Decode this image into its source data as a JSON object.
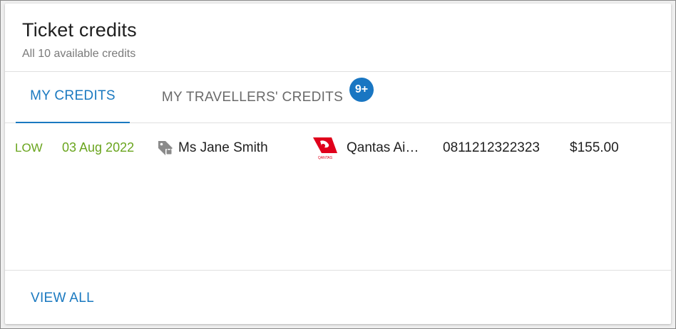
{
  "header": {
    "title": "Ticket credits",
    "subtitle": "All 10 available credits"
  },
  "tabs": [
    {
      "label": "MY CREDITS",
      "active": true
    },
    {
      "label": "MY TRAVELLERS' CREDITS",
      "active": false,
      "badge": "9+"
    }
  ],
  "credits": [
    {
      "status": "LOW",
      "date": "03 Aug 2022",
      "traveller_icon": "tag-lock-icon",
      "traveller": "Ms Jane Smith",
      "airline_icon": "qantas-logo",
      "airline": "Qantas Airways",
      "airline_display": "Qantas Ai…",
      "ticket_number": "0811212322323",
      "amount": "$155.00"
    }
  ],
  "footer": {
    "view_all_label": "VIEW ALL"
  },
  "colors": {
    "accent": "#1a79c0",
    "badge": "#1976c2",
    "status_low": "#6aa51e",
    "qantas_red": "#e0001b"
  }
}
